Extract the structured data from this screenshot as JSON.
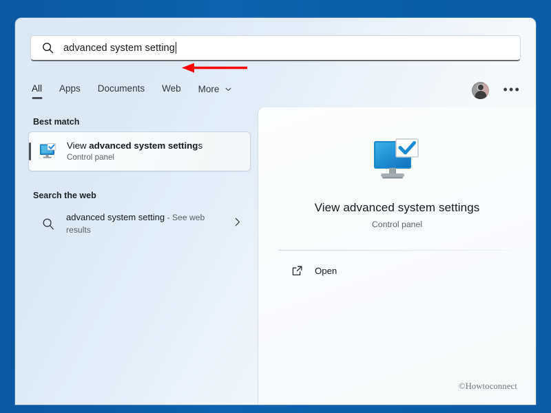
{
  "window": {
    "backdrop_color": "#0c5ba6",
    "panel_bg_start": "#dbe9f5",
    "panel_bg_end": "#f7f8f8"
  },
  "search": {
    "icon": "search-icon",
    "value": "advanced system setting",
    "placeholder": "Type here to search"
  },
  "annotation": {
    "type": "arrow",
    "direction": "left",
    "color": "#ff0000"
  },
  "tabs": [
    {
      "label": "All",
      "active": true
    },
    {
      "label": "Apps",
      "active": false
    },
    {
      "label": "Documents",
      "active": false
    },
    {
      "label": "Web",
      "active": false
    },
    {
      "label": "More",
      "active": false,
      "chevron": "chevron-down-icon"
    }
  ],
  "header_actions": {
    "avatar": "account-avatar",
    "more_label": "•••"
  },
  "results": {
    "best_match": {
      "section_title": "Best match",
      "icon": "system-properties-icon",
      "title_prefix": "View ",
      "title_match": "advanced system setting",
      "title_suffix": "s",
      "subtitle": "Control panel",
      "selected": true
    },
    "web": {
      "section_title": "Search the web",
      "icon": "search-icon",
      "query": "advanced system setting",
      "suffix": " - See web results",
      "chevron": "chevron-right-icon"
    }
  },
  "preview": {
    "icon": "system-properties-icon",
    "title": "View advanced system settings",
    "subtitle": "Control panel",
    "actions": [
      {
        "icon": "open-external-icon",
        "label": "Open"
      }
    ]
  },
  "watermark": {
    "text": "©Howtoconnect"
  }
}
